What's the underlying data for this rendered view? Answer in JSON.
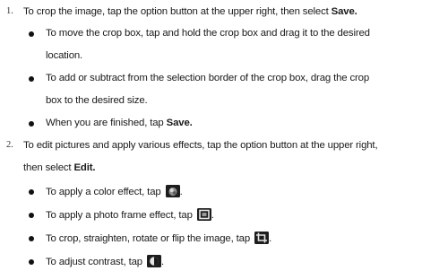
{
  "items": [
    {
      "number": "1.",
      "text_before": "To crop the image, tap the option button at the upper right, then select ",
      "bold": "Save.",
      "bullets": [
        {
          "line1": "To move the crop box, tap and hold the crop box and drag it to the desired",
          "line2": "location."
        },
        {
          "line1": "To add or subtract from the selection border of the crop box, drag the crop",
          "line2": "box to the desired size."
        },
        {
          "text_before": "When you are finished, tap ",
          "bold": "Save."
        }
      ]
    },
    {
      "number": "2.",
      "line1": "To edit pictures and apply various effects, tap the option button at the upper right,",
      "line2_before": "then select ",
      "line2_bold": "Edit.",
      "bullets": [
        {
          "text": "To apply a color effect, tap",
          "icon": "color-effect-icon",
          "end": "."
        },
        {
          "text": "To apply a photo frame effect, tap",
          "icon": "photo-frame-icon",
          "end": "."
        },
        {
          "text": "To crop, straighten, rotate or flip the image, tap",
          "icon": "crop-icon",
          "end": "."
        },
        {
          "text": "To adjust contrast, tap",
          "icon": "contrast-icon",
          "end": "."
        }
      ]
    }
  ]
}
